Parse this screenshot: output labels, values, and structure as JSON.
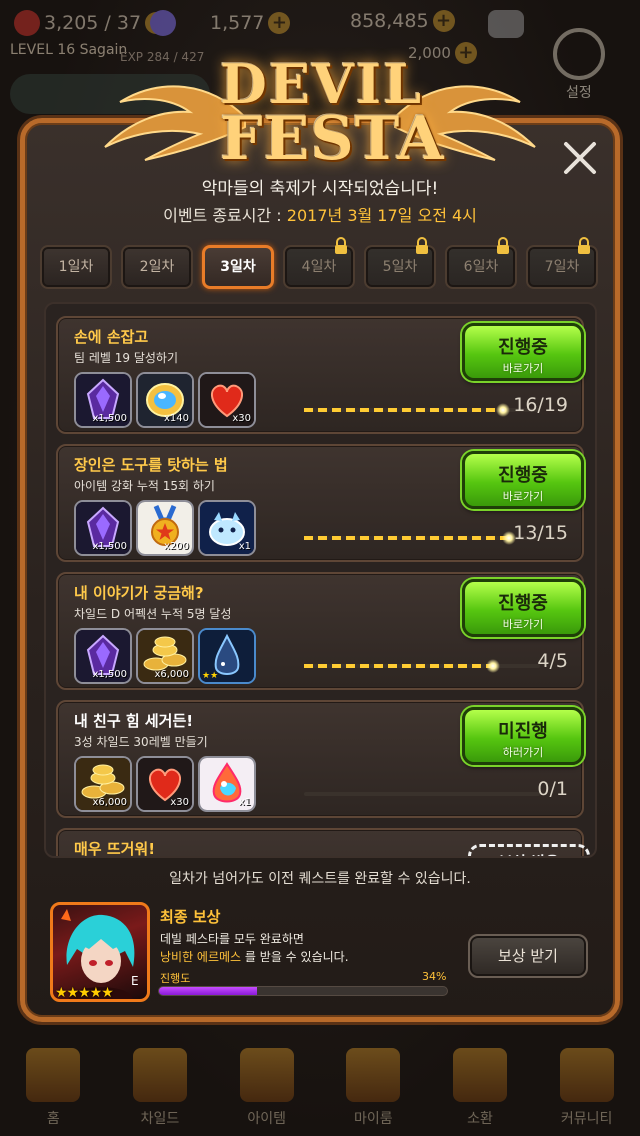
{
  "hud": {
    "stamina": "3,205 / 37",
    "gems": "1,577",
    "gold": "858,485",
    "level": "LEVEL 16",
    "player_name": "Sagain",
    "exp": "EXP 284 / 427",
    "gold_secondary": "2,000",
    "settings_label": "설정"
  },
  "logo": {
    "line1": "DEVIL",
    "line2": "FESTA"
  },
  "intro": {
    "headline": "악마들의 축제가 시작되었습니다!",
    "end_label": "이벤트 종료시간 : ",
    "end_time": "2017년 3월 17일 오전 4시"
  },
  "tabs": [
    {
      "label": "1일차",
      "state": "normal"
    },
    {
      "label": "2일차",
      "state": "normal"
    },
    {
      "label": "3일차",
      "state": "active"
    },
    {
      "label": "4일차",
      "state": "locked"
    },
    {
      "label": "5일차",
      "state": "locked"
    },
    {
      "label": "6일차",
      "state": "locked"
    },
    {
      "label": "7일차",
      "state": "locked"
    }
  ],
  "quests": [
    {
      "title": "손에 손잡고",
      "desc": "팀 레벨 19 달성하기",
      "button": "진행중",
      "button_sub": "바로가기",
      "current": 16,
      "target": 19,
      "count_text": "16/19",
      "rewards": [
        {
          "icon": "dark-crystal-icon",
          "qty": "x1,500"
        },
        {
          "icon": "rainbow-gem-icon",
          "qty": "x140"
        },
        {
          "icon": "heart-icon",
          "qty": "x30"
        }
      ]
    },
    {
      "title": "장인은 도구를 탓하는 법",
      "desc": "아이템 강화 누적 15회 하기",
      "button": "진행중",
      "button_sub": "바로가기",
      "current": 13,
      "target": 15,
      "count_text": "13/15",
      "rewards": [
        {
          "icon": "dark-crystal-icon",
          "qty": "x1,500"
        },
        {
          "icon": "medal-icon",
          "qty": "x200"
        },
        {
          "icon": "spirit-creature-icon",
          "qty": "x1"
        }
      ]
    },
    {
      "title": "내 이야기가 궁금해?",
      "desc": "차일드 D 어펙션 누적 5명 달성",
      "button": "진행중",
      "button_sub": "바로가기",
      "current": 4,
      "target": 5,
      "count_text": "4/5",
      "rewards": [
        {
          "icon": "dark-crystal-icon",
          "qty": "x1,500"
        },
        {
          "icon": "gold-coins-icon",
          "qty": "x6,000"
        },
        {
          "icon": "blue-drop-child-icon",
          "qty": ""
        }
      ]
    },
    {
      "title": "내 친구 힘 세거든!",
      "desc": "3성 차일드 30레벨 만들기",
      "button": "미진행",
      "button_sub": "하러가기",
      "current": 0,
      "target": 1,
      "count_text": "0/1",
      "rewards": [
        {
          "icon": "gold-coins-icon",
          "qty": "x6,000"
        },
        {
          "icon": "heart-icon",
          "qty": "x30"
        },
        {
          "icon": "rainbow-drop-icon",
          "qty": "x1"
        }
      ]
    },
    {
      "title": "매우 뜨거워!",
      "button": "보상 받음"
    }
  ],
  "note": "일차가 넘어가도 이전 퀘스트를 완료할 수 있습니다.",
  "final_reward": {
    "title": "최종 보상",
    "line1": "데빌 페스타를 모두 완료하면",
    "highlight": "낭비한 에르메스",
    "line2_rest": " 를 받을 수 있습니다.",
    "progress_label": "진행도",
    "progress_pct": 34,
    "progress_text": "34%",
    "stars": "★★★★★",
    "claim_button": "보상 받기"
  },
  "bottom_nav": [
    "홈",
    "차일드",
    "아이템",
    "마이룸",
    "소환",
    "커뮤니티"
  ],
  "colors": {
    "accent_orange": "#e87c28",
    "gold_text": "#ffc94a",
    "green_button": "#56c610",
    "purple_progress": "#8a1ad8"
  }
}
